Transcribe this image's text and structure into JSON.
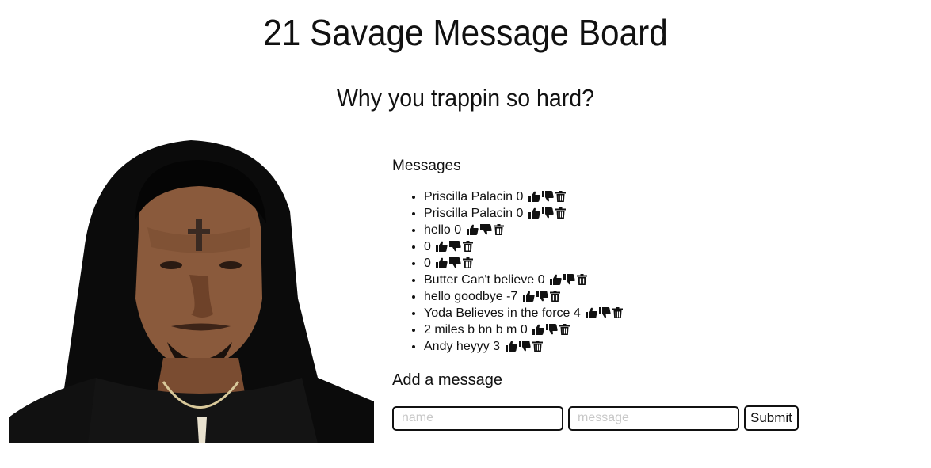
{
  "header": {
    "title": "21 Savage Message Board",
    "subtitle": "Why you trappin so hard?"
  },
  "board": {
    "messages_heading": "Messages",
    "add_heading": "Add a message",
    "messages": [
      {
        "text": "Priscilla Palacin 0"
      },
      {
        "text": "Priscilla Palacin 0"
      },
      {
        "text": "hello 0"
      },
      {
        "text": "0"
      },
      {
        "text": "0"
      },
      {
        "text": "Butter Can't believe 0"
      },
      {
        "text": "hello goodbye -7"
      },
      {
        "text": "Yoda Believes in the force 4"
      },
      {
        "text": "2 miles b bn b m 0"
      },
      {
        "text": "Andy heyyy 3"
      }
    ],
    "icons": [
      "thumbs-up-icon",
      "thumbs-down-icon",
      "trash-icon"
    ]
  },
  "form": {
    "name_placeholder": "name",
    "message_placeholder": "message",
    "submit_label": "Submit"
  }
}
